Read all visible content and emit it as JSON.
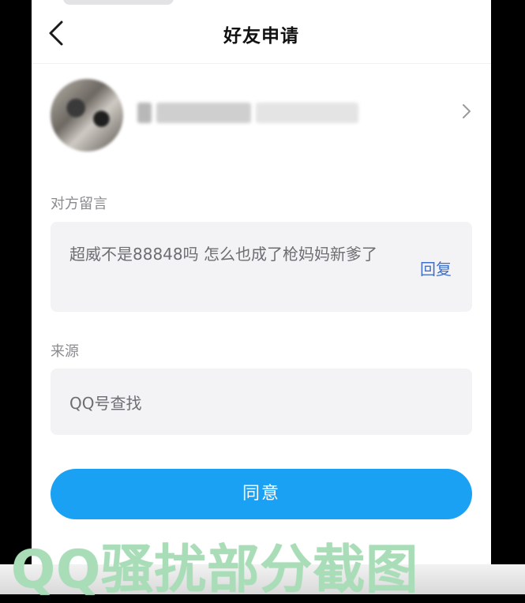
{
  "header": {
    "title": "好友申请"
  },
  "profile": {
    "name_visible_prefix": "*"
  },
  "message_section": {
    "label": "对方留言",
    "message": "超威不是88848吗 怎么也成了枪妈妈新爹了",
    "reply_label": "回复"
  },
  "source_section": {
    "label": "来源",
    "value": "QQ号查找"
  },
  "actions": {
    "agree_label": "同意"
  },
  "overlay": {
    "watermark": "QQ骚扰部分截图"
  },
  "colors": {
    "accent": "#1aa1f3",
    "link": "#3f6fc9",
    "card_bg": "#f3f3f5",
    "watermark": "#a8ddb8"
  },
  "icons": {
    "back": "chevron-left-icon",
    "profile_arrow": "chevron-right-icon"
  }
}
